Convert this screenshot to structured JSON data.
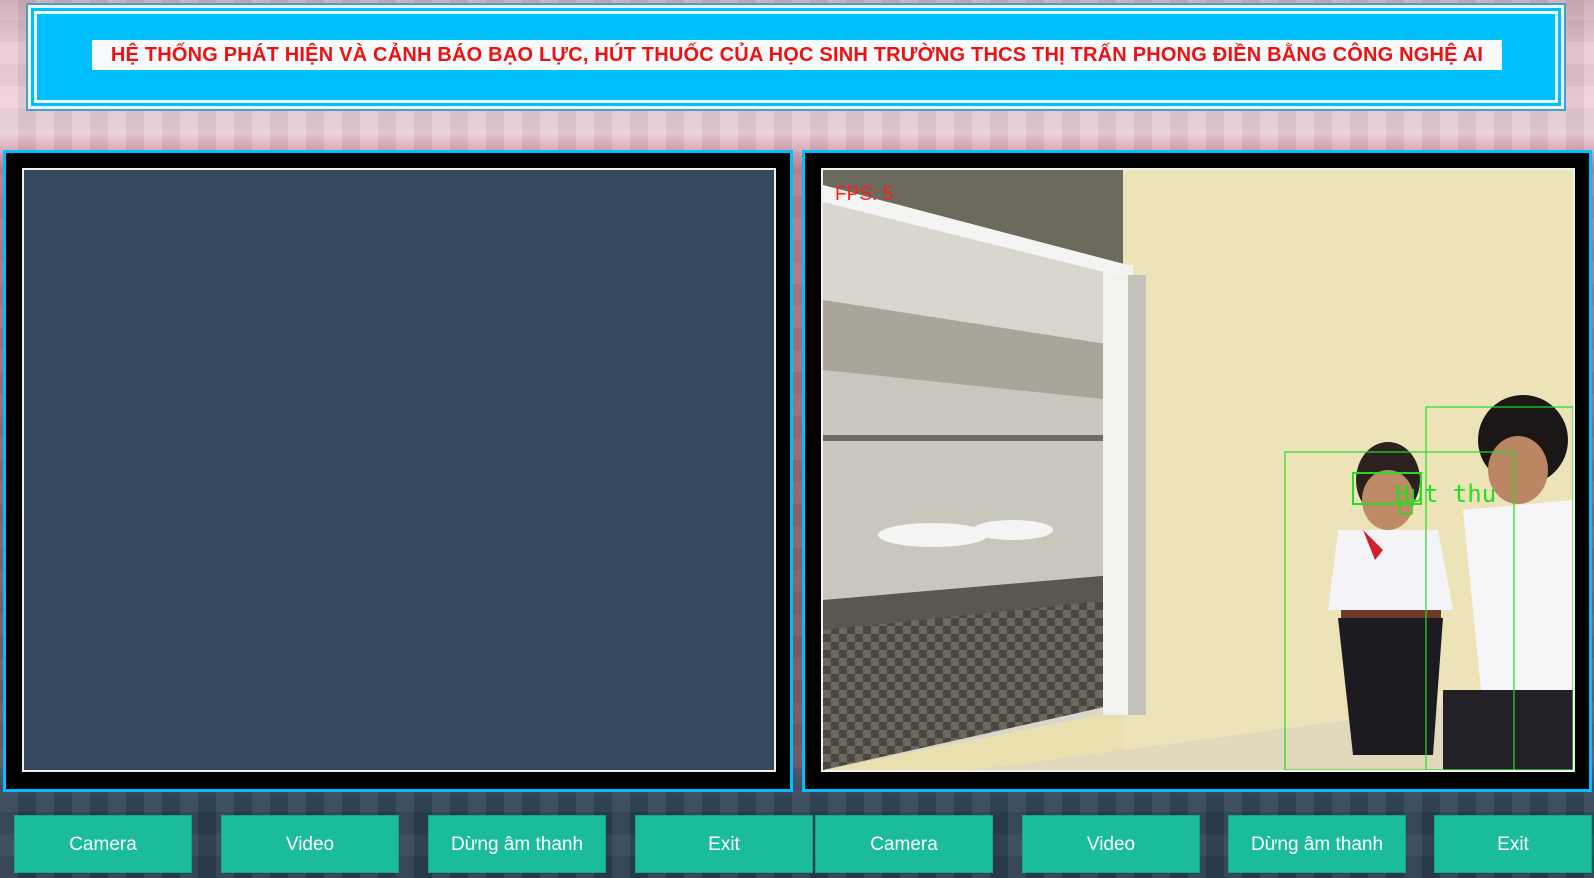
{
  "header": {
    "title": "HỆ THỐNG PHÁT HIỆN VÀ CẢNH BÁO BẠO LỰC, HÚT THUỐC CỦA HỌC SINH TRƯỜNG THCS THỊ TRẤN PHONG ĐIỀN BẰNG CÔNG NGHỆ AI"
  },
  "right_panel": {
    "fps_text": "FPS: 5",
    "detection_label": "Hut thu"
  },
  "left_controls": {
    "camera": "Camera",
    "video": "Video",
    "stop_sound": "Dừng âm thanh",
    "exit": "Exit"
  },
  "right_controls": {
    "camera": "Camera",
    "video": "Video",
    "stop_sound": "Dừng âm thanh",
    "exit": "Exit"
  },
  "colors": {
    "accent": "#00bfff",
    "button": "#1abc9c",
    "screen_bg": "#34495e",
    "title_text": "#ee1111",
    "fps_text": "#ff1a1a",
    "detection_box": "#22dd22"
  }
}
